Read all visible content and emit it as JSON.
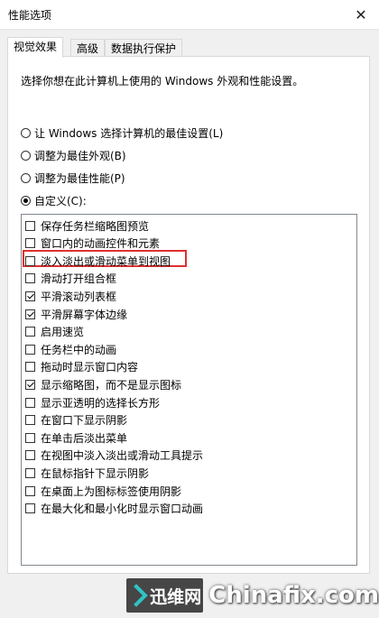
{
  "window": {
    "title": "性能选项",
    "close_symbol": "✕"
  },
  "tabs": [
    {
      "label": "视觉效果"
    },
    {
      "label": "高级"
    },
    {
      "label": "数据执行保护"
    }
  ],
  "panel": {
    "description": "选择你想在此计算机上使用的 Windows 外观和性能设置。",
    "radios": [
      {
        "label": "让 Windows 选择计算机的最佳设置(L)",
        "checked": false
      },
      {
        "label": "调整为最佳外观(B)",
        "checked": false
      },
      {
        "label": "调整为最佳性能(P)",
        "checked": false
      },
      {
        "label": "自定义(C):",
        "checked": true
      }
    ],
    "options": [
      {
        "label": "保存任务栏缩略图预览",
        "checked": false
      },
      {
        "label": "窗口内的动画控件和元素",
        "checked": false
      },
      {
        "label": "淡入淡出或滑动菜单到视图",
        "checked": false
      },
      {
        "label": "滑动打开组合框",
        "checked": false
      },
      {
        "label": "平滑滚动列表框",
        "checked": true
      },
      {
        "label": "平滑屏幕字体边缘",
        "checked": true
      },
      {
        "label": "启用速览",
        "checked": false
      },
      {
        "label": "任务栏中的动画",
        "checked": false
      },
      {
        "label": "拖动时显示窗口内容",
        "checked": false
      },
      {
        "label": "显示缩略图，而不是显示图标",
        "checked": true
      },
      {
        "label": "显示亚透明的选择长方形",
        "checked": false
      },
      {
        "label": "在窗口下显示阴影",
        "checked": false
      },
      {
        "label": "在单击后淡出菜单",
        "checked": false
      },
      {
        "label": "在视图中淡入淡出或滑动工具提示",
        "checked": false
      },
      {
        "label": "在鼠标指针下显示阴影",
        "checked": false
      },
      {
        "label": "在桌面上为图标标签使用阴影",
        "checked": false
      },
      {
        "label": "在最大化和最小化时显示窗口动画",
        "checked": false
      }
    ],
    "highlight_color": "#e0302e"
  },
  "watermark": {
    "logo_text": "迅维网",
    "site_text": "Chinafix.com"
  }
}
